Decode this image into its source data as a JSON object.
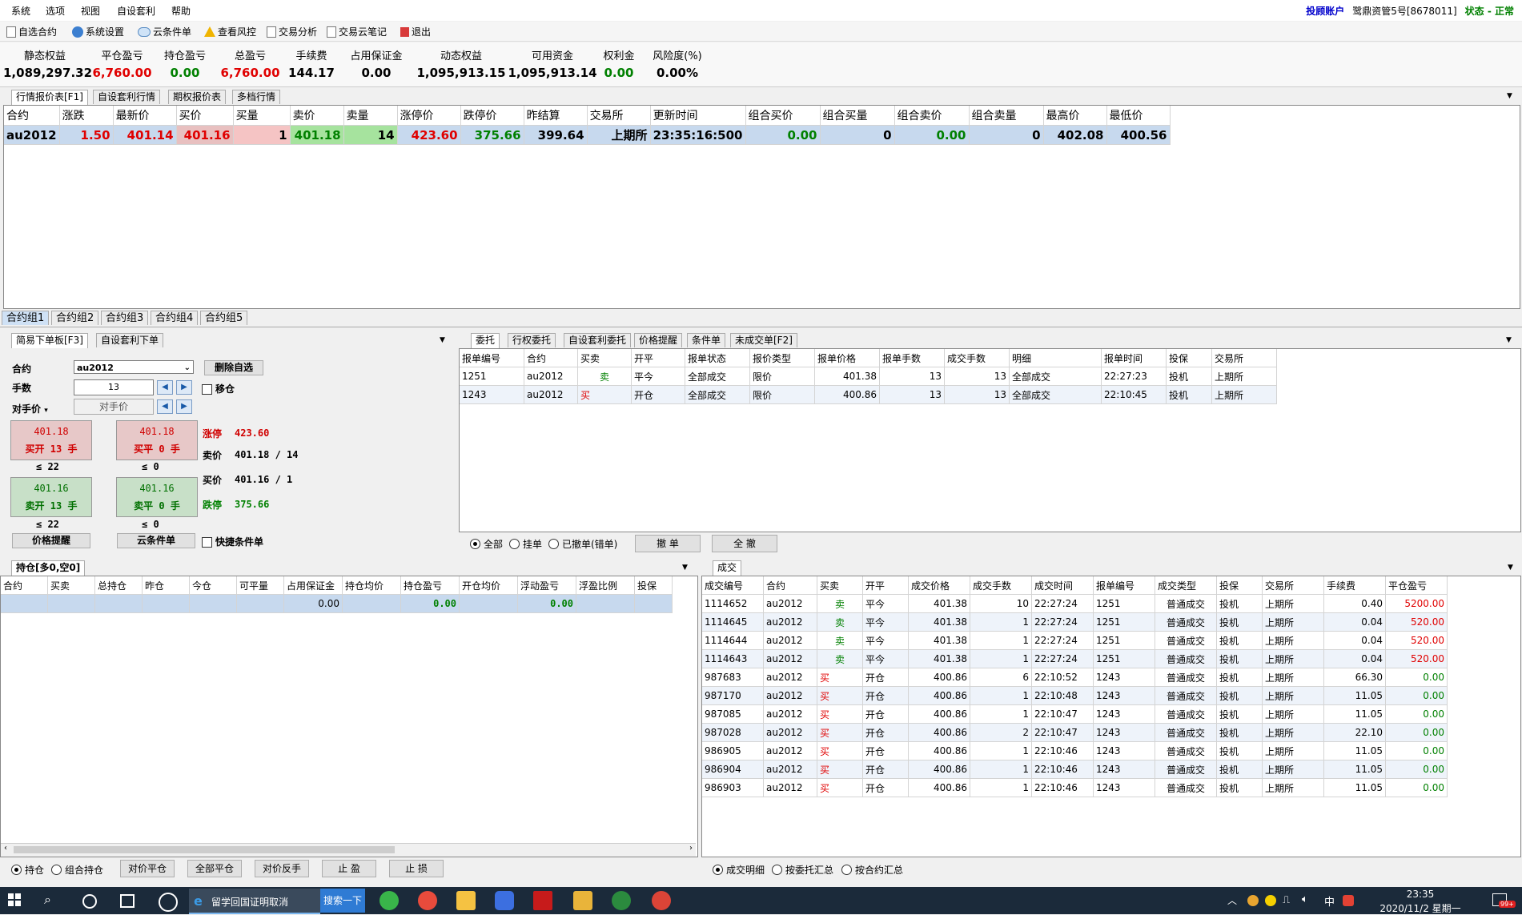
{
  "menu": [
    "系统",
    "选项",
    "视图",
    "自设套利",
    "帮助"
  ],
  "account": {
    "type": "投顾账户",
    "name": "鹭鼎资管5号[8678011]",
    "status": "状态 - 正常"
  },
  "toolbar": [
    "自选合约",
    "系统设置",
    "云条件单",
    "查看风控",
    "交易分析",
    "交易云笔记",
    "退出"
  ],
  "metrics": [
    {
      "label": "静态权益",
      "value": "1,089,297.32",
      "color": "black"
    },
    {
      "label": "平仓盈亏",
      "value": "6,760.00",
      "color": "red"
    },
    {
      "label": "持仓盈亏",
      "value": "0.00",
      "color": "green"
    },
    {
      "label": "总盈亏",
      "value": "6,760.00",
      "color": "red"
    },
    {
      "label": "手续费",
      "value": "144.17",
      "color": "black"
    },
    {
      "label": "占用保证金",
      "value": "0.00",
      "color": "black"
    },
    {
      "label": "动态权益",
      "value": "1,095,913.15",
      "color": "black"
    },
    {
      "label": "可用资金",
      "value": "1,095,913.14",
      "color": "black"
    },
    {
      "label": "权利金",
      "value": "0.00",
      "color": "green"
    },
    {
      "label": "风险度(%)",
      "value": "0.00%",
      "color": "black"
    }
  ],
  "quote_tabs": [
    "行情报价表[F1]",
    "自设套利行情",
    "期权报价表",
    "多档行情"
  ],
  "quote": {
    "headers": [
      "合约",
      "涨跌",
      "最新价",
      "买价",
      "买量",
      "卖价",
      "卖量",
      "涨停价",
      "跌停价",
      "昨结算",
      "交易所",
      "更新时间",
      "组合买价",
      "组合买量",
      "组合卖价",
      "组合卖量",
      "最高价",
      "最低价"
    ],
    "row": [
      "au2012",
      "1.50",
      "401.14",
      "401.16",
      "1",
      "401.18",
      "14",
      "423.60",
      "375.66",
      "399.64",
      "上期所",
      "23:35:16:500",
      "0.00",
      "0",
      "0.00",
      "0",
      "402.08",
      "400.56"
    ]
  },
  "group_tabs": [
    "合约组1",
    "合约组2",
    "合约组3",
    "合约组4",
    "合约组5"
  ],
  "order_tabs": [
    "简易下单板[F3]",
    "自设套利下单"
  ],
  "order": {
    "contract_label": "合约",
    "contract_value": "au2012",
    "qty_label": "手数",
    "qty_value": "13",
    "price_mode": "对手价",
    "price_placeholder": "对手价",
    "delete_btn": "删除自选",
    "move_chk": "移仓",
    "buy_open": {
      "price": "401.18",
      "text": "买开 13 手"
    },
    "buy_close": {
      "price": "401.18",
      "text": "买平 0 手"
    },
    "sell_open": {
      "price": "401.16",
      "text": "卖开 13 手"
    },
    "sell_close": {
      "price": "401.16",
      "text": "卖平 0 手"
    },
    "buy_open_lim": "≤ 22",
    "buy_close_lim": "≤ 0",
    "sell_open_lim": "≤ 22",
    "sell_close_lim": "≤ 0",
    "limit_up_label": "涨停",
    "limit_up": "423.60",
    "ask_label": "卖价",
    "ask": "401.18 / 14",
    "bid_label": "买价",
    "bid": "401.16 / 1",
    "limit_down_label": "跌停",
    "limit_down": "375.66",
    "price_alert_btn": "价格提醒",
    "cloud_cond_btn": "云条件单",
    "quick_cond": "快捷条件单"
  },
  "entrust_tabs": [
    "委托",
    "行权委托",
    "自设套利委托",
    "价格提醒",
    "条件单",
    "未成交单[F2]"
  ],
  "entrust": {
    "headers": [
      "报单编号",
      "合约",
      "买卖",
      "开平",
      "报单状态",
      "报价类型",
      "报单价格",
      "报单手数",
      "成交手数",
      "明细",
      "报单时间",
      "投保",
      "交易所"
    ],
    "rows": [
      [
        "1251",
        "au2012",
        "卖",
        "平今",
        "全部成交",
        "限价",
        "401.38",
        "13",
        "13",
        "全部成交",
        "22:27:23",
        "投机",
        "上期所"
      ],
      [
        "1243",
        "au2012",
        "买",
        "开仓",
        "全部成交",
        "限价",
        "400.86",
        "13",
        "13",
        "全部成交",
        "22:10:45",
        "投机",
        "上期所"
      ]
    ],
    "filters": [
      "全部",
      "挂单",
      "已撤单(错单)"
    ],
    "cancel_btn": "撤 单",
    "cancel_all_btn": "全 撤"
  },
  "position_tab": "持仓[多0,空0]",
  "position": {
    "headers": [
      "合约",
      "买卖",
      "总持仓",
      "昨仓",
      "今仓",
      "可平量",
      "占用保证金",
      "持仓均价",
      "持仓盈亏",
      "开仓均价",
      "浮动盈亏",
      "浮盈比例",
      "投保"
    ],
    "row": [
      "",
      "",
      "",
      "",
      "",
      "",
      "0.00",
      "",
      "0.00",
      "",
      "0.00",
      "",
      ""
    ],
    "filters": [
      "持仓",
      "组合持仓"
    ],
    "buttons": [
      "对价平仓",
      "全部平仓",
      "对价反手",
      "止 盈",
      "止 损"
    ]
  },
  "trade_tab": "成交",
  "trades": {
    "headers": [
      "成交编号",
      "合约",
      "买卖",
      "开平",
      "成交价格",
      "成交手数",
      "成交时间",
      "报单编号",
      "成交类型",
      "投保",
      "交易所",
      "手续费",
      "平仓盈亏"
    ],
    "rows": [
      [
        "1114652",
        "au2012",
        "卖",
        "平今",
        "401.38",
        "10",
        "22:27:24",
        "1251",
        "普通成交",
        "投机",
        "上期所",
        "0.40",
        "5200.00"
      ],
      [
        "1114645",
        "au2012",
        "卖",
        "平今",
        "401.38",
        "1",
        "22:27:24",
        "1251",
        "普通成交",
        "投机",
        "上期所",
        "0.04",
        "520.00"
      ],
      [
        "1114644",
        "au2012",
        "卖",
        "平今",
        "401.38",
        "1",
        "22:27:24",
        "1251",
        "普通成交",
        "投机",
        "上期所",
        "0.04",
        "520.00"
      ],
      [
        "1114643",
        "au2012",
        "卖",
        "平今",
        "401.38",
        "1",
        "22:27:24",
        "1251",
        "普通成交",
        "投机",
        "上期所",
        "0.04",
        "520.00"
      ],
      [
        "987683",
        "au2012",
        "买",
        "开仓",
        "400.86",
        "6",
        "22:10:52",
        "1243",
        "普通成交",
        "投机",
        "上期所",
        "66.30",
        "0.00"
      ],
      [
        "987170",
        "au2012",
        "买",
        "开仓",
        "400.86",
        "1",
        "22:10:48",
        "1243",
        "普通成交",
        "投机",
        "上期所",
        "11.05",
        "0.00"
      ],
      [
        "987085",
        "au2012",
        "买",
        "开仓",
        "400.86",
        "1",
        "22:10:47",
        "1243",
        "普通成交",
        "投机",
        "上期所",
        "11.05",
        "0.00"
      ],
      [
        "987028",
        "au2012",
        "买",
        "开仓",
        "400.86",
        "2",
        "22:10:47",
        "1243",
        "普通成交",
        "投机",
        "上期所",
        "22.10",
        "0.00"
      ],
      [
        "986905",
        "au2012",
        "买",
        "开仓",
        "400.86",
        "1",
        "22:10:46",
        "1243",
        "普通成交",
        "投机",
        "上期所",
        "11.05",
        "0.00"
      ],
      [
        "986904",
        "au2012",
        "买",
        "开仓",
        "400.86",
        "1",
        "22:10:46",
        "1243",
        "普通成交",
        "投机",
        "上期所",
        "11.05",
        "0.00"
      ],
      [
        "986903",
        "au2012",
        "买",
        "开仓",
        "400.86",
        "1",
        "22:10:46",
        "1243",
        "普通成交",
        "投机",
        "上期所",
        "11.05",
        "0.00"
      ]
    ],
    "filters": [
      "成交明细",
      "按委托汇总",
      "按合约汇总"
    ]
  },
  "taskbar": {
    "search_tab": "留学回国证明取消",
    "search_btn": "搜索一下",
    "ime": "中",
    "time": "23:35",
    "date": "2020/11/2 星期一",
    "badge": "99+"
  }
}
